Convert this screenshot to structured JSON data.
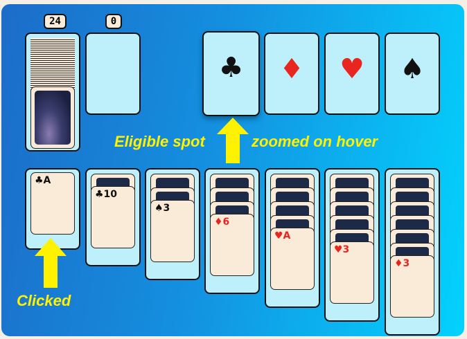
{
  "stock": {
    "count": "24"
  },
  "waste": {
    "count": "0"
  },
  "foundations": [
    {
      "suit": "♣",
      "color": "#111111",
      "hovered": true
    },
    {
      "suit": "♦",
      "color": "#e8261f"
    },
    {
      "suit": "♥",
      "color": "#e8261f"
    },
    {
      "suit": "♠",
      "color": "#111111"
    }
  ],
  "tableau": [
    {
      "down": 0,
      "face": "♣A",
      "red": false
    },
    {
      "down": 1,
      "face": "♣10",
      "red": false
    },
    {
      "down": 2,
      "face": "♠3",
      "red": false
    },
    {
      "down": 3,
      "face": "♦6",
      "red": true
    },
    {
      "down": 4,
      "face": "♥A",
      "red": true
    },
    {
      "down": 5,
      "face": "♥3",
      "red": true
    },
    {
      "down": 6,
      "face": "♦3",
      "red": true
    }
  ],
  "annotations": {
    "eligible": "Eligible spot",
    "zoomed": "zoomed on hover",
    "clicked": "Clicked"
  },
  "colors": {
    "arrow": "#fff200",
    "slot": "#bdf0fb",
    "card": "#faebd8"
  }
}
